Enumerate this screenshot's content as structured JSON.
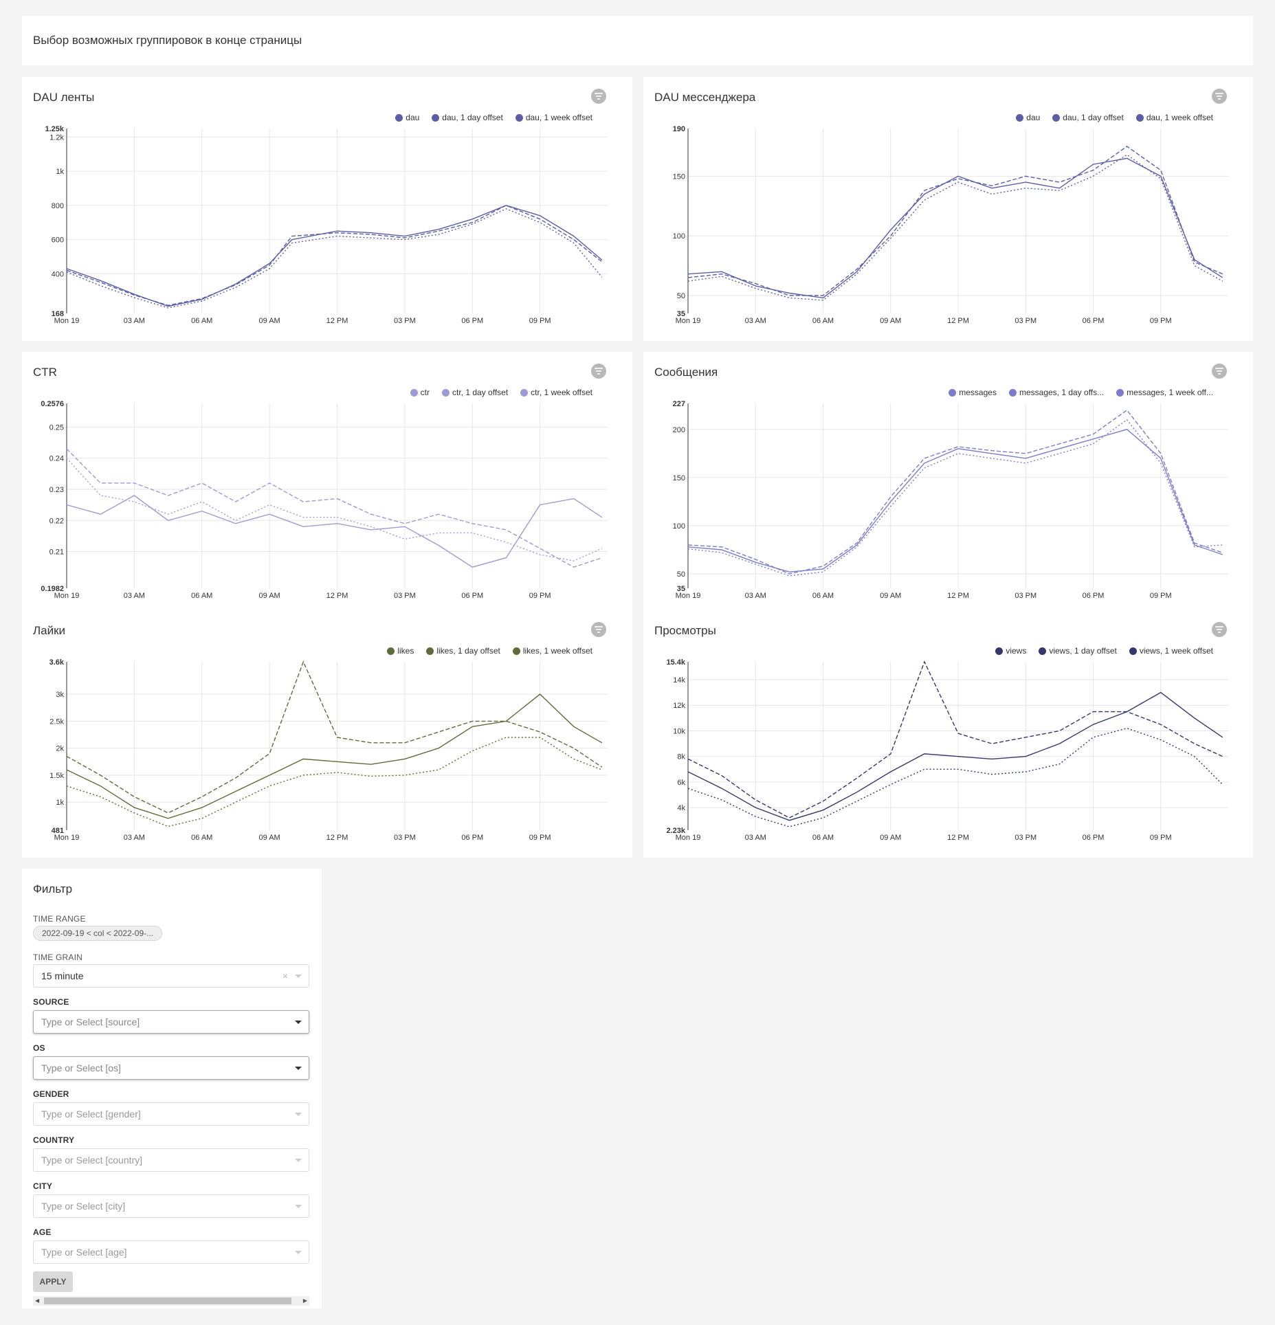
{
  "header": {
    "text": "Выбор возможных группировок в конце страницы"
  },
  "x_ticks": [
    "Mon 19",
    "03 AM",
    "06 AM",
    "09 AM",
    "12 PM",
    "03 PM",
    "06 PM",
    "09 PM"
  ],
  "charts": [
    {
      "id": "dau_feed",
      "title": "DAU ленты",
      "color": "#5b5ea6",
      "legend": [
        "dau",
        "dau, 1 day offset",
        "dau, 1 week offset"
      ],
      "y_ticks": [
        "1.25k",
        "1.2k",
        "1k",
        "800",
        "600",
        "400",
        "168"
      ],
      "y_tick_values": [
        1250,
        1200,
        1000,
        800,
        600,
        400,
        168
      ]
    },
    {
      "id": "dau_msg",
      "title": "DAU мессенджера",
      "color": "#5b5ea6",
      "legend": [
        "dau",
        "dau, 1 day offset",
        "dau, 1 week offset"
      ],
      "y_ticks": [
        "190",
        "150",
        "100",
        "50",
        "35"
      ],
      "y_tick_values": [
        190,
        150,
        100,
        50,
        35
      ]
    },
    {
      "id": "ctr",
      "title": "CTR",
      "color": "#9c9bd6",
      "legend": [
        "ctr",
        "ctr, 1 day offset",
        "ctr, 1 week offset"
      ],
      "y_ticks": [
        "0.2576",
        "0.25",
        "0.24",
        "0.23",
        "0.22",
        "0.21",
        "0.1982"
      ],
      "y_tick_values": [
        0.2576,
        0.25,
        0.24,
        0.23,
        0.22,
        0.21,
        0.1982
      ]
    },
    {
      "id": "messages",
      "title": "Сообщения",
      "color": "#7b7ccc",
      "legend": [
        "messages",
        "messages, 1 day offs...",
        "messages, 1 week off..."
      ],
      "y_ticks": [
        "227",
        "200",
        "150",
        "100",
        "50",
        "35"
      ],
      "y_tick_values": [
        227,
        200,
        150,
        100,
        50,
        35
      ]
    },
    {
      "id": "likes",
      "title": "Лайки",
      "color": "#5e6b3a",
      "legend": [
        "likes",
        "likes, 1 day offset",
        "likes, 1 week offset"
      ],
      "y_ticks": [
        "3.6k",
        "3k",
        "2.5k",
        "2k",
        "1.5k",
        "1k",
        "481"
      ],
      "y_tick_values": [
        3600,
        3000,
        2500,
        2000,
        1500,
        1000,
        481
      ]
    },
    {
      "id": "views",
      "title": "Просмотры",
      "color": "#33376b",
      "legend": [
        "views",
        "views, 1 day offset",
        "views, 1 week offset"
      ],
      "y_ticks": [
        "15.4k",
        "14k",
        "12k",
        "10k",
        "8k",
        "6k",
        "4k",
        "2.23k"
      ],
      "y_tick_values": [
        15400,
        14000,
        12000,
        10000,
        8000,
        6000,
        4000,
        2230
      ]
    }
  ],
  "chart_data": [
    {
      "type": "line",
      "title": "DAU ленты",
      "ylim": [
        168,
        1250
      ],
      "x": [
        "00:00",
        "01:30",
        "03:00",
        "04:30",
        "06:00",
        "07:30",
        "09:00",
        "10:00",
        "12:00",
        "13:30",
        "15:00",
        "16:30",
        "18:00",
        "19:30",
        "21:00",
        "22:30",
        "23:45"
      ],
      "series": [
        {
          "name": "dau",
          "values": [
            430,
            360,
            280,
            210,
            250,
            340,
            460,
            600,
            650,
            640,
            620,
            660,
            720,
            800,
            740,
            620,
            480
          ]
        },
        {
          "name": "dau, 1 day offset",
          "values": [
            420,
            350,
            275,
            215,
            255,
            335,
            450,
            620,
            640,
            630,
            610,
            650,
            700,
            800,
            720,
            600,
            470
          ]
        },
        {
          "name": "dau, 1 week offset",
          "values": [
            410,
            330,
            260,
            200,
            240,
            320,
            430,
            580,
            620,
            610,
            600,
            630,
            690,
            780,
            700,
            580,
            380
          ]
        }
      ]
    },
    {
      "type": "line",
      "title": "DAU мессенджера",
      "ylim": [
        35,
        190
      ],
      "x": [
        "00:00",
        "01:30",
        "03:00",
        "04:30",
        "06:00",
        "07:30",
        "09:00",
        "10:30",
        "12:00",
        "13:30",
        "15:00",
        "16:30",
        "18:00",
        "19:30",
        "21:00",
        "22:30",
        "23:45"
      ],
      "series": [
        {
          "name": "dau",
          "values": [
            68,
            70,
            58,
            52,
            48,
            70,
            105,
            135,
            150,
            140,
            145,
            140,
            160,
            165,
            150,
            80,
            65
          ]
        },
        {
          "name": "dau, 1 day offset",
          "values": [
            65,
            68,
            60,
            50,
            50,
            72,
            100,
            138,
            148,
            142,
            150,
            145,
            155,
            175,
            155,
            78,
            68
          ]
        },
        {
          "name": "dau, 1 week offset",
          "values": [
            62,
            66,
            56,
            48,
            46,
            68,
            98,
            130,
            145,
            135,
            140,
            138,
            150,
            168,
            148,
            75,
            62
          ]
        }
      ]
    },
    {
      "type": "line",
      "title": "CTR",
      "ylim": [
        0.1982,
        0.2576
      ],
      "x": [
        "00:00",
        "01:30",
        "03:00",
        "04:30",
        "06:00",
        "07:30",
        "09:00",
        "10:30",
        "12:00",
        "13:30",
        "15:00",
        "16:30",
        "18:00",
        "19:30",
        "21:00",
        "22:30",
        "23:45"
      ],
      "series": [
        {
          "name": "ctr",
          "values": [
            0.225,
            0.222,
            0.228,
            0.22,
            0.223,
            0.219,
            0.222,
            0.218,
            0.219,
            0.217,
            0.218,
            0.212,
            0.205,
            0.208,
            0.225,
            0.227,
            0.221
          ]
        },
        {
          "name": "ctr, 1 day offset",
          "values": [
            0.243,
            0.232,
            0.232,
            0.228,
            0.232,
            0.226,
            0.232,
            0.226,
            0.227,
            0.222,
            0.219,
            0.222,
            0.219,
            0.217,
            0.211,
            0.205,
            0.208
          ]
        },
        {
          "name": "ctr, 1 week offset",
          "values": [
            0.24,
            0.228,
            0.226,
            0.222,
            0.226,
            0.22,
            0.225,
            0.221,
            0.221,
            0.218,
            0.214,
            0.216,
            0.216,
            0.213,
            0.209,
            0.207,
            0.211
          ]
        }
      ]
    },
    {
      "type": "line",
      "title": "Сообщения",
      "ylim": [
        35,
        227
      ],
      "x": [
        "00:00",
        "01:30",
        "03:00",
        "04:30",
        "06:00",
        "07:30",
        "09:00",
        "10:30",
        "12:00",
        "13:30",
        "15:00",
        "16:30",
        "18:00",
        "19:30",
        "21:00",
        "22:30",
        "23:45"
      ],
      "series": [
        {
          "name": "messages",
          "values": [
            78,
            75,
            62,
            52,
            55,
            80,
            125,
            165,
            180,
            175,
            170,
            180,
            190,
            200,
            170,
            80,
            70
          ]
        },
        {
          "name": "messages, 1 day offs...",
          "values": [
            80,
            78,
            65,
            50,
            58,
            82,
            130,
            170,
            182,
            178,
            175,
            185,
            195,
            220,
            175,
            82,
            72
          ]
        },
        {
          "name": "messages, 1 week off...",
          "values": [
            76,
            72,
            60,
            48,
            52,
            78,
            120,
            160,
            175,
            170,
            165,
            175,
            185,
            210,
            165,
            78,
            80
          ]
        }
      ]
    },
    {
      "type": "line",
      "title": "Лайки",
      "ylim": [
        481,
        3600
      ],
      "x": [
        "00:00",
        "01:30",
        "03:00",
        "04:30",
        "06:00",
        "07:30",
        "09:00",
        "10:30",
        "12:00",
        "13:30",
        "15:00",
        "16:30",
        "18:00",
        "19:30",
        "21:00",
        "22:30",
        "23:45"
      ],
      "series": [
        {
          "name": "likes",
          "values": [
            1600,
            1300,
            900,
            700,
            900,
            1200,
            1500,
            1800,
            1750,
            1700,
            1800,
            2000,
            2400,
            2500,
            3000,
            2400,
            2100
          ]
        },
        {
          "name": "likes, 1 day offset",
          "values": [
            1850,
            1500,
            1100,
            800,
            1100,
            1450,
            1900,
            3600,
            2200,
            2100,
            2100,
            2300,
            2500,
            2500,
            2300,
            2000,
            1650
          ]
        },
        {
          "name": "likes, 1 week offset",
          "values": [
            1300,
            1100,
            800,
            550,
            700,
            1000,
            1300,
            1500,
            1550,
            1480,
            1500,
            1600,
            1950,
            2200,
            2200,
            1800,
            1600
          ]
        }
      ]
    },
    {
      "type": "line",
      "title": "Просмотры",
      "ylim": [
        2230,
        15400
      ],
      "x": [
        "00:00",
        "01:30",
        "03:00",
        "04:30",
        "06:00",
        "07:30",
        "09:00",
        "10:30",
        "12:00",
        "13:30",
        "15:00",
        "16:30",
        "18:00",
        "19:30",
        "21:00",
        "22:30",
        "23:45"
      ],
      "series": [
        {
          "name": "views",
          "values": [
            6800,
            5500,
            4000,
            3000,
            3800,
            5200,
            6800,
            8200,
            8000,
            7800,
            8000,
            9000,
            10500,
            11500,
            13000,
            11000,
            9500
          ]
        },
        {
          "name": "views, 1 day offset",
          "values": [
            7800,
            6500,
            4600,
            3200,
            4500,
            6300,
            8200,
            15400,
            9800,
            9000,
            9500,
            10000,
            11500,
            11500,
            10500,
            9000,
            8000
          ]
        },
        {
          "name": "views, 1 week offset",
          "values": [
            5500,
            4600,
            3300,
            2500,
            3200,
            4500,
            5800,
            7000,
            7000,
            6600,
            6800,
            7400,
            9500,
            10200,
            9300,
            8000,
            5800
          ]
        }
      ]
    }
  ],
  "filter": {
    "title": "Фильтр",
    "time_range_label": "TIME RANGE",
    "time_range_value": "2022-09-19 < col < 2022-09-...",
    "time_grain_label": "TIME GRAIN",
    "time_grain_value": "15 minute",
    "time_grain_clear": "×",
    "fields": [
      {
        "label": "SOURCE",
        "placeholder": "Type or Select [source]"
      },
      {
        "label": "OS",
        "placeholder": "Type or Select [os]"
      },
      {
        "label": "GENDER",
        "placeholder": "Type or Select [gender]"
      },
      {
        "label": "COUNTRY",
        "placeholder": "Type or Select [country]"
      },
      {
        "label": "CITY",
        "placeholder": "Type or Select [city]"
      },
      {
        "label": "AGE",
        "placeholder": "Type or Select [age]"
      }
    ],
    "apply_label": "APPLY"
  }
}
